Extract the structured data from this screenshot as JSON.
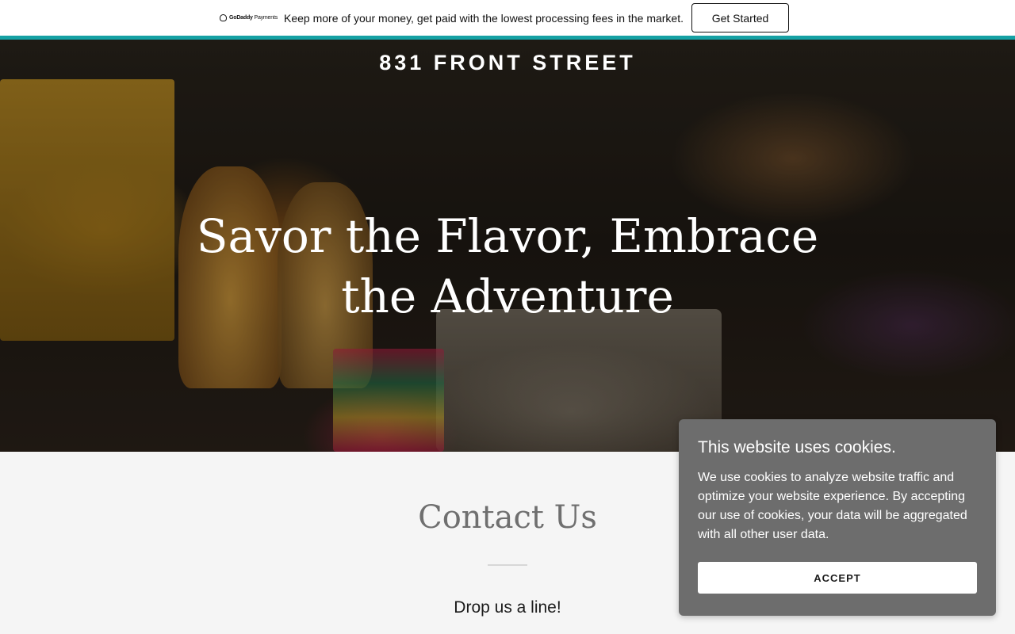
{
  "promo": {
    "logo_brand": "GoDaddy",
    "logo_product": "Payments",
    "message": "Keep more of your money, get paid with the lowest processing fees in the market.",
    "cta_label": "Get Started"
  },
  "colors": {
    "accent": "#15a1a4",
    "cookie_bg": "#6d6d6d",
    "contact_bg": "#f5f5f5"
  },
  "hero": {
    "site_title": "831 FRONT STREET",
    "headline_line1": "Savor the Flavor, Embrace",
    "headline_line2": "the Adventure"
  },
  "contact": {
    "title": "Contact Us",
    "subtitle": "Drop us a line!"
  },
  "cookie_banner": {
    "title": "This website uses cookies.",
    "body": "We use cookies to analyze website traffic and optimize your website experience. By accepting our use of cookies, your data will be aggregated with all other user data.",
    "accept_label": "ACCEPT"
  }
}
